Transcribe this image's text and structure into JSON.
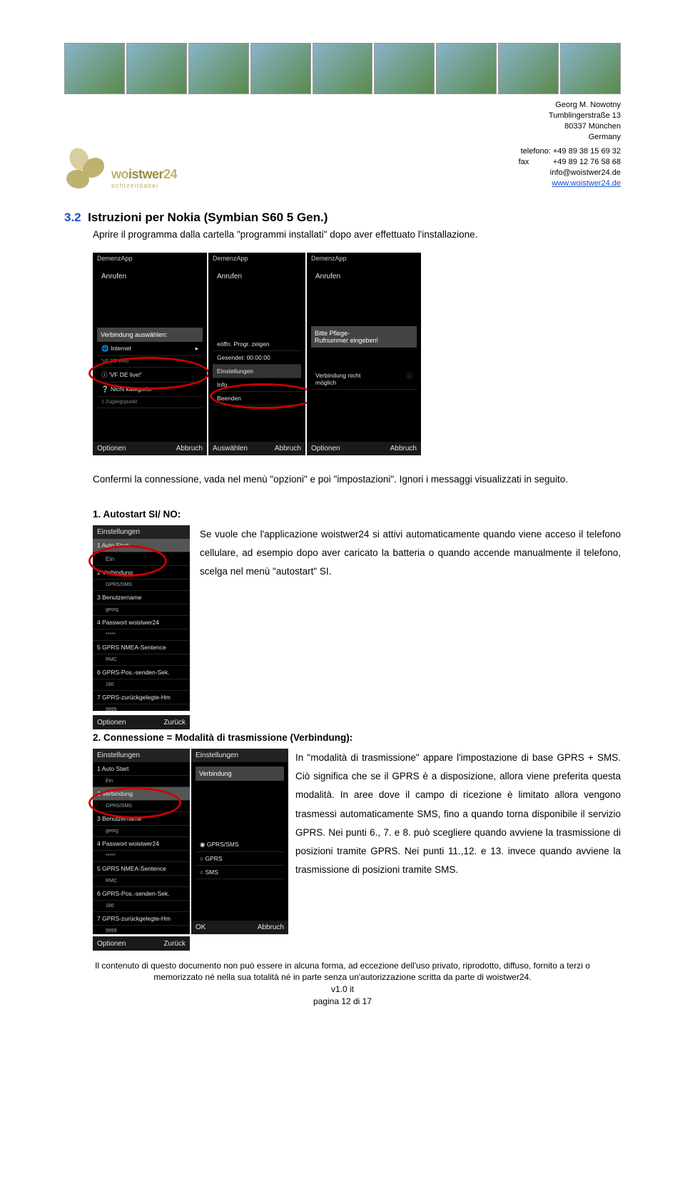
{
  "contact": {
    "name": "Georg M. Nowotny",
    "street": "Tumblingerstraße 13",
    "city": "80337 München",
    "country": "Germany",
    "phone_label": "telefono:",
    "phone": "+49  89  38 15 69 32",
    "fax_label": "fax",
    "fax": "+49  89  12 76 58 68",
    "email": "info@woistwer24.de",
    "web": "www.woistwer24.de"
  },
  "logo": {
    "pre": "wo",
    "mid": "istwer",
    "post": "24",
    "sub": "echtzeitdabei"
  },
  "sec32": {
    "num": "3.2",
    "title": "Istruzioni per Nokia (Symbian S60 5 Gen.)",
    "intro": "Aprire il programma dalla cartella \"programmi installati\" dopo aver effettuato l'installazione.",
    "after_shots": "Confermi la connessione, vada nel menù \"opzioni\" e poi \"impostazioni\". Ignori i messaggi visualizzati in seguito."
  },
  "autostart": {
    "heading": "1. Autostart SI/ NO:",
    "body": "Se vuole che l'applicazione woistwer24 si attivi automaticamente quando viene acceso il telefono cellulare, ad esempio dopo aver caricato la batteria o quando accende manualmente il telefono, scelga nel menù \"autostart\" SI."
  },
  "conn": {
    "heading": "2. Connessione = Modalità di trasmissione (Verbindung):",
    "body": "In \"modalità di trasmissione\" appare l'impostazione di base GPRS + SMS. Ciò significa che se il GPRS è a disposizione, allora viene preferita questa modalità. In aree dove il campo di ricezione è limitato allora vengono trasmessi automaticamente SMS, fino a quando torna disponibile il servizio GPRS. Nei punti 6., 7. e 8. può scegliere quando avviene la trasmissione di posizioni tramite GPRS. Nei punti 11.,12. e 13. invece quando avviene la trasmissione di posizioni tramite SMS."
  },
  "footer": {
    "l1": "Il contenuto di questo documento non può essere in alcuna forma, ad eccezione dell'uso privato, riprodotto, diffuso, fornito a terzi o",
    "l2": "memorizzato né nella sua totalità né in parte senza un'autorizzazione scritta da parte di woistwer24.",
    "ver": "v1.0 it",
    "page": "pagina 12 di 17"
  },
  "shots": {
    "topApp": "DemenzApp",
    "anrufen": "Anrufen",
    "s1_label": "Verbindung auswählen:",
    "s1_a": "Internet",
    "s1_a2": "'VF DE Web'",
    "s1_b": "'VF DE live!'",
    "s1_c": "Nicht kategoris.",
    "s1_c2": "1 Zugangspunkt",
    "opt": "Optionen",
    "abbr": "Abbruch",
    "ausw": "Auswählen",
    "zur": "Zurück",
    "ok": "OK",
    "s2_a": "eöffn. Progr. zeigen",
    "s2_b": "Gesendet: 00:00:00",
    "s2_c": "Einstellungen",
    "s2_d": "Info",
    "s2_e": "Beenden",
    "s3_a": "Bitte Pflege-",
    "s3_b": "Rufnummer eingeben!",
    "s3_c": "Verbindung nicht",
    "s3_d": "möglich",
    "einst": "Einstellungen",
    "set1": "Auto Start",
    "set1v": "Ein",
    "set2": "Verbindung",
    "set2v": "GPRS/SMS",
    "set3": "Benutzername",
    "set3v": "georg",
    "set4": "Passwort woistwer24",
    "set4v": "*****",
    "set5": "GPRS NMEA-Sentence",
    "set5v": "RMC",
    "set6": "GPRS-Pos.-senden-Sek.",
    "set6v": "180",
    "set7": "GPRS-zurückgelegte-Hm",
    "set7v": "9999",
    "verb": "Verbindung",
    "opt_a": "GPRS/SMS",
    "opt_b": "GPRS",
    "opt_c": "SMS"
  }
}
